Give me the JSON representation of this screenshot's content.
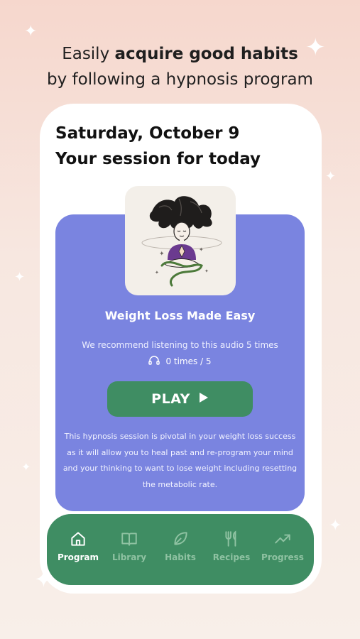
{
  "headline": {
    "line1_prefix": "Easily ",
    "line1_bold": "acquire good habits",
    "line2": "by following a hypnosis program"
  },
  "header": {
    "date": "Saturday, October 9",
    "subtitle": "Your session for today"
  },
  "session": {
    "title": "Weight Loss Made Easy",
    "recommendation": "We recommend listening to this audio 5 times",
    "listen_count": "0 times / 5",
    "play_label": "PLAY",
    "description": "This hypnosis session is pivotal in your weight loss success as it will allow you to heal past and re-program your mind and your thinking to want to lose weight including resetting the metabolic rate."
  },
  "nav": {
    "items": [
      {
        "label": "Program",
        "icon": "home-icon",
        "active": true
      },
      {
        "label": "Library",
        "icon": "book-icon",
        "active": false
      },
      {
        "label": "Habits",
        "icon": "leaf-icon",
        "active": false
      },
      {
        "label": "Recipes",
        "icon": "fork-knife-icon",
        "active": false
      },
      {
        "label": "Progress",
        "icon": "trend-up-icon",
        "active": false
      }
    ]
  },
  "colors": {
    "card": "#7a84e0",
    "accent_green": "#3f8d63",
    "nav_inactive": "#8fc2a2"
  }
}
